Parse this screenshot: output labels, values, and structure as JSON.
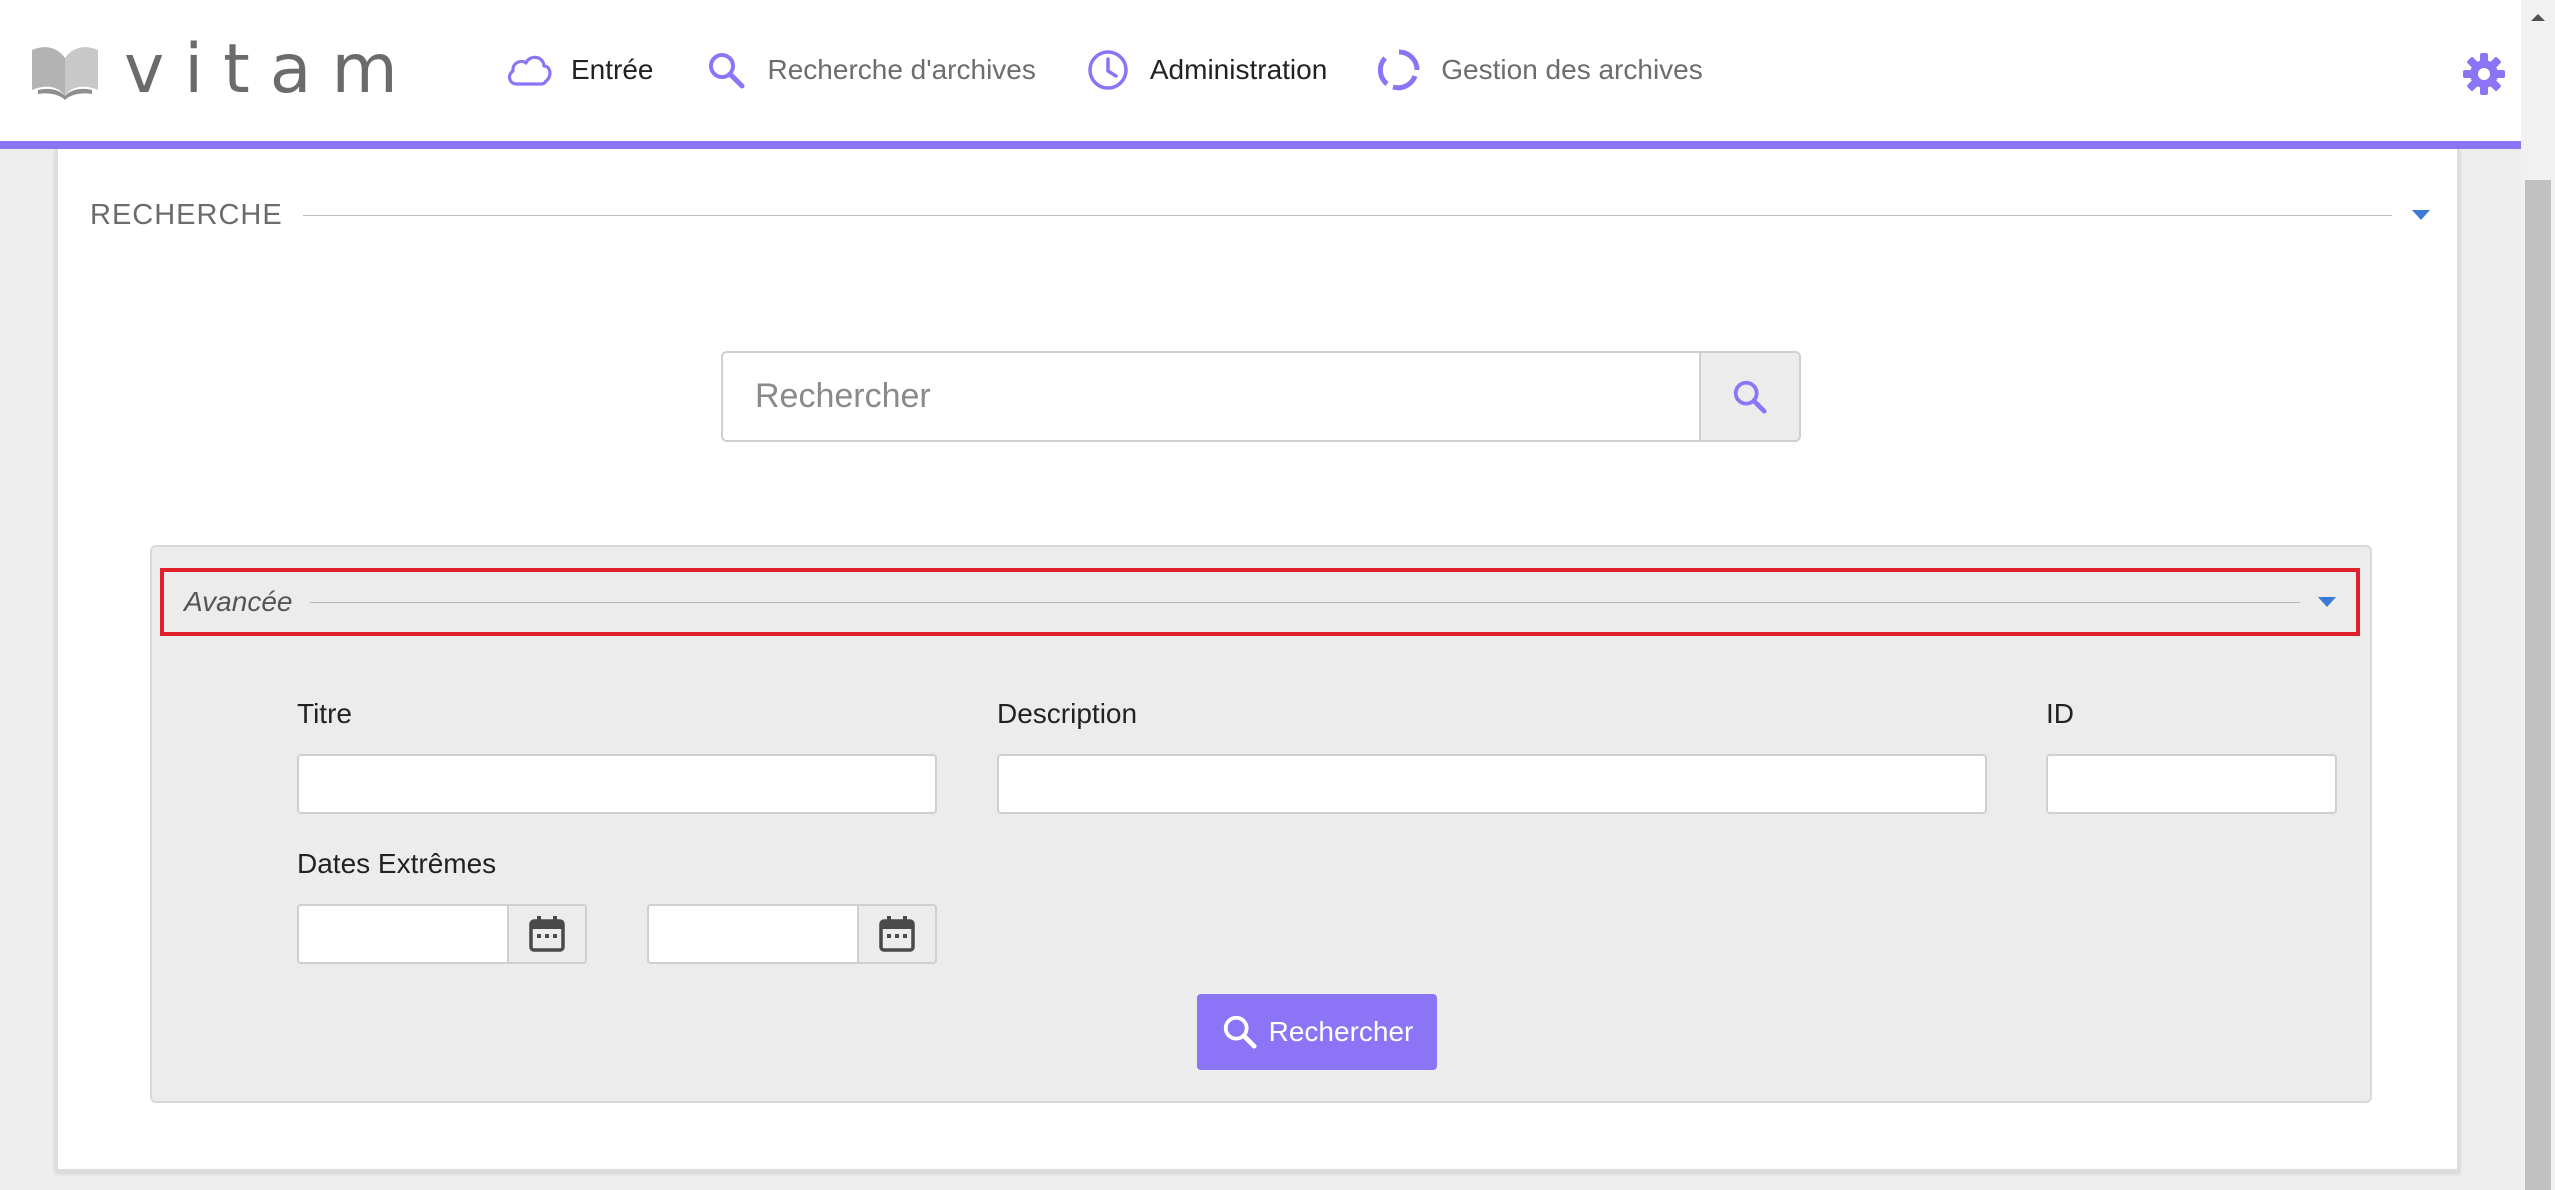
{
  "brand": {
    "name": "vitam"
  },
  "nav": {
    "items": [
      {
        "label": "Entrée",
        "icon": "cloud-icon"
      },
      {
        "label": "Recherche d'archives",
        "icon": "search-icon"
      },
      {
        "label": "Administration",
        "icon": "clock-icon"
      },
      {
        "label": "Gestion des archives",
        "icon": "circular-arrows-icon"
      }
    ],
    "settings_icon": "gear-icon"
  },
  "search": {
    "section_title": "RECHERCHE",
    "placeholder": "Rechercher"
  },
  "advanced": {
    "title": "Avancée",
    "fields": {
      "titre_label": "Titre",
      "description_label": "Description",
      "id_label": "ID",
      "dates_label": "Dates Extrêmes"
    },
    "submit_label": "Rechercher"
  },
  "colors": {
    "accent": "#8b74f6",
    "highlight_border": "#e0202a",
    "caret": "#3a7bd5"
  }
}
